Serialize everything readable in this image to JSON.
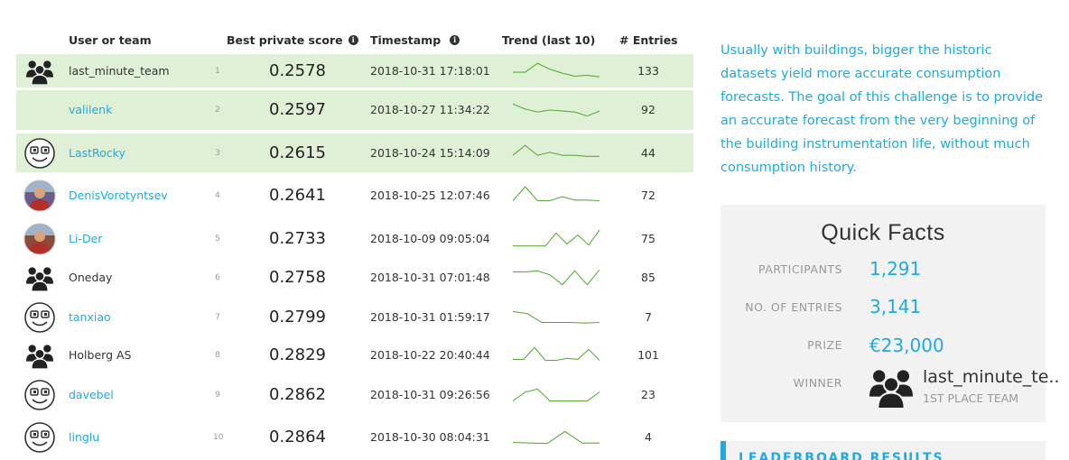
{
  "leaderboard": {
    "columns": {
      "user": "User or team",
      "score": "Best private score",
      "score_info": "i",
      "timestamp": "Timestamp",
      "timestamp_info": "i",
      "trend": "Trend (last 10)",
      "entries": "# Entries"
    },
    "rows": [
      {
        "avatar": "team-icon",
        "name": "last_minute_team",
        "rank": "1",
        "score": "0.2578",
        "timestamp": "2018-10-31 17:18:01",
        "entries": "133",
        "trend": [
          0.55,
          0.55,
          0.1,
          0.4,
          0.6,
          0.75,
          0.7,
          0.78
        ]
      },
      {
        "avatar": "none",
        "name": "valilenk",
        "rank": "2",
        "score": "0.2597",
        "timestamp": "2018-10-27 11:34:22",
        "entries": "92",
        "trend": [
          0.2,
          0.45,
          0.6,
          0.5,
          0.55,
          0.6,
          0.8,
          0.55
        ]
      },
      {
        "avatar": "robot-face-icon",
        "name": "LastRocky",
        "rank": "3",
        "score": "0.2615",
        "timestamp": "2018-10-24 15:14:09",
        "entries": "44",
        "trend": [
          0.6,
          0.1,
          0.6,
          0.45,
          0.6,
          0.6,
          0.65,
          0.65
        ]
      },
      {
        "avatar": "user-photo",
        "name": "DenisVorotyntsev",
        "rank": "4",
        "score": "0.2641",
        "timestamp": "2018-10-25 12:07:46",
        "entries": "72",
        "trend": [
          0.75,
          0.05,
          0.75,
          0.75,
          0.55,
          0.72,
          0.72,
          0.75
        ]
      },
      {
        "avatar": "user-photo",
        "name": "Li-Der",
        "rank": "5",
        "score": "0.2733",
        "timestamp": "2018-10-09 09:05:04",
        "entries": "75",
        "trend": [
          0.85,
          0.85,
          0.85,
          0.85,
          0.2,
          0.75,
          0.3,
          0.8,
          0.05
        ]
      },
      {
        "avatar": "team-icon",
        "name": "Oneday",
        "rank": "6",
        "score": "0.2758",
        "timestamp": "2018-10-31 07:01:48",
        "entries": "85",
        "trend": [
          0.2,
          0.2,
          0.15,
          0.35,
          0.85,
          0.15,
          0.85,
          0.1
        ]
      },
      {
        "avatar": "robot-face-icon",
        "name": "tanxiao",
        "rank": "7",
        "score": "0.2799",
        "timestamp": "2018-10-31 01:59:17",
        "entries": "7",
        "trend": [
          0.2,
          0.3,
          0.75,
          0.75,
          0.75,
          0.78,
          0.75
        ]
      },
      {
        "avatar": "team-icon",
        "name": "Holberg AS",
        "rank": "8",
        "score": "0.2829",
        "timestamp": "2018-10-22 20:40:44",
        "entries": "101",
        "trend": [
          0.7,
          0.7,
          0.1,
          0.75,
          0.75,
          0.65,
          0.7,
          0.2,
          0.75
        ]
      },
      {
        "avatar": "robot-face-icon",
        "name": "davebel",
        "rank": "9",
        "score": "0.2862",
        "timestamp": "2018-10-31 09:26:56",
        "entries": "23",
        "trend": [
          0.8,
          0.35,
          0.2,
          0.8,
          0.8,
          0.8,
          0.8,
          0.35
        ]
      },
      {
        "avatar": "robot-face-icon",
        "name": "linglu",
        "rank": "10",
        "score": "0.2864",
        "timestamp": "2018-10-30 08:04:31",
        "entries": "4",
        "trend": [
          0.75,
          0.78,
          0.8,
          0.2,
          0.78,
          0.78
        ]
      }
    ]
  },
  "sidebar": {
    "description": "Usually with buildings, bigger the historic datasets yield more accurate consumption forecasts. The goal of this challenge is to provide an accurate forecast from the very beginning of the building instrumentation life, without much consumption history.",
    "quick_facts": {
      "title": "Quick Facts",
      "participants_label": "PARTICIPANTS",
      "participants_value": "1,291",
      "entries_label": "NO. OF ENTRIES",
      "entries_value": "3,141",
      "prize_label": "PRIZE",
      "prize_value": "€23,000",
      "winner_label": "WINNER",
      "winner_name": "last_minute_te...",
      "winner_sub": "1ST PLACE TEAM"
    },
    "leaderboard_results": "LEADERBOARD RESULTS"
  },
  "colors": {
    "accent": "#21a9e1",
    "highlight_row": "#e0f0d6",
    "trend_line": "#5cab3c"
  }
}
